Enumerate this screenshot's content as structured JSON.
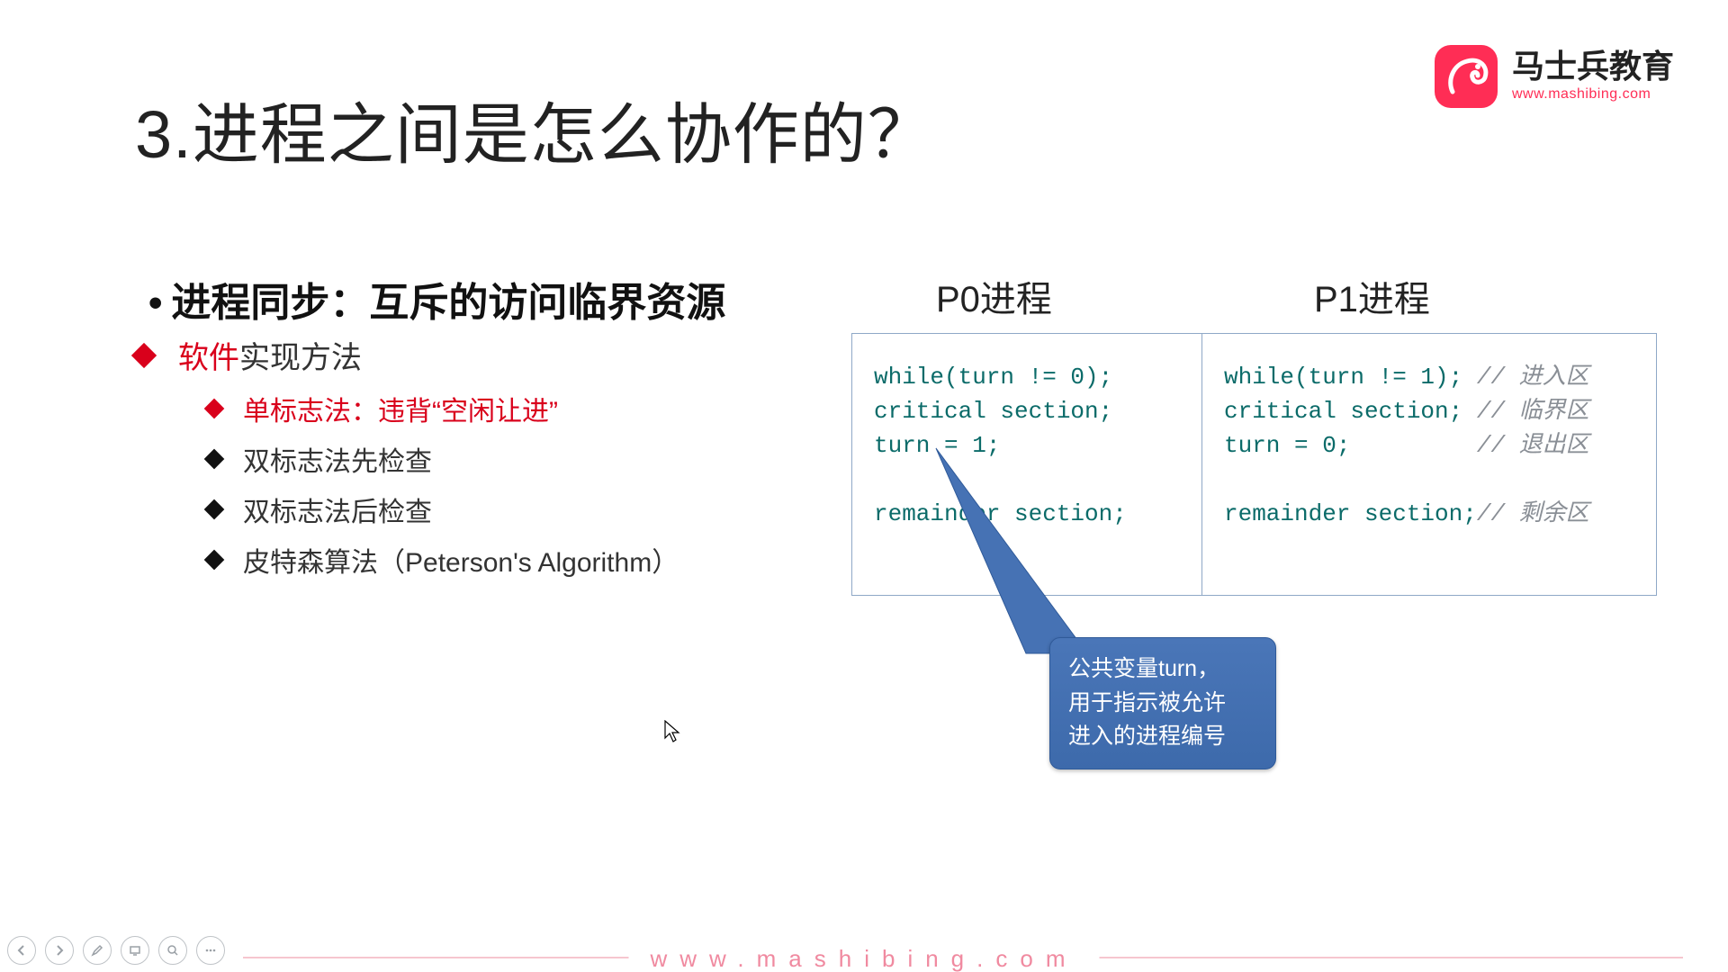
{
  "slide": {
    "title": "3.进程之间是怎么协作的？",
    "subtitle": "进程同步：互斥的访问临界资源",
    "bullet_main_highlight": "软件",
    "bullet_main_rest": "实现方法",
    "sub_bullets": [
      {
        "text": "单标志法：违背“空闲让进”",
        "highlight": true
      },
      {
        "text": "双标志法先检查",
        "highlight": false
      },
      {
        "text": "双标志法后检查",
        "highlight": false
      },
      {
        "text": "皮特森算法（Peterson's Algorithm）",
        "highlight": false
      }
    ],
    "labels": {
      "p0": "P0进程",
      "p1": "P1进程"
    },
    "code": {
      "p0": {
        "line1": "while(turn != 0);",
        "line2": "critical section;",
        "line3": "turn = 1;",
        "line4": "",
        "line5": "remainder section;"
      },
      "p1": {
        "l1a": "while(turn != 1); ",
        "l1c": "// 进入区",
        "l2a": "critical section; ",
        "l2c": "// 临界区",
        "l3a": "turn = 0;         ",
        "l3c": "// 退出区",
        "l4a": "",
        "l5a": "remainder section;",
        "l5c": "// 剩余区"
      }
    },
    "callout": {
      "line1": "公共变量turn，",
      "line2": "用于指示被允许",
      "line3": "进入的进程编号"
    }
  },
  "brand": {
    "cn": "马士兵教育",
    "en": "www.mashibing.com"
  },
  "footer": {
    "url": "www.mashibing.com"
  }
}
